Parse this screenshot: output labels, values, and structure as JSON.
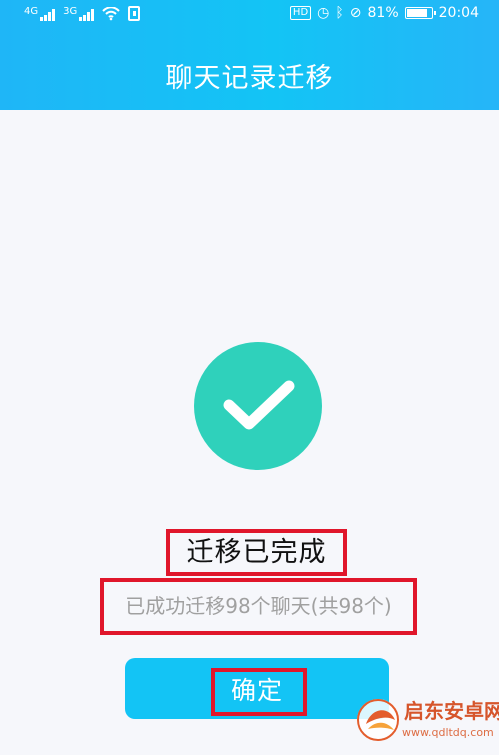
{
  "statusbar": {
    "network_left": "4G",
    "network_right": "3G",
    "hd_label": "HD",
    "battery_percent": "81%",
    "time": "20:04"
  },
  "header": {
    "title": "聊天记录迁移"
  },
  "result": {
    "title": "迁移已完成",
    "message": "已成功迁移98个聊天(共98个)",
    "confirm_label": "确定"
  },
  "watermark": {
    "title": "启东安卓网",
    "url": "www.qdltdq.com"
  },
  "colors": {
    "header": "#13c4f5",
    "success": "#2fd1bb",
    "highlight": "#e0162b"
  },
  "icons": {
    "success": "check-circle-icon",
    "wifi": "wifi-icon",
    "alarm": "alarm-icon",
    "bluetooth": "bluetooth-icon",
    "mute": "mute-icon",
    "battery": "battery-icon"
  }
}
